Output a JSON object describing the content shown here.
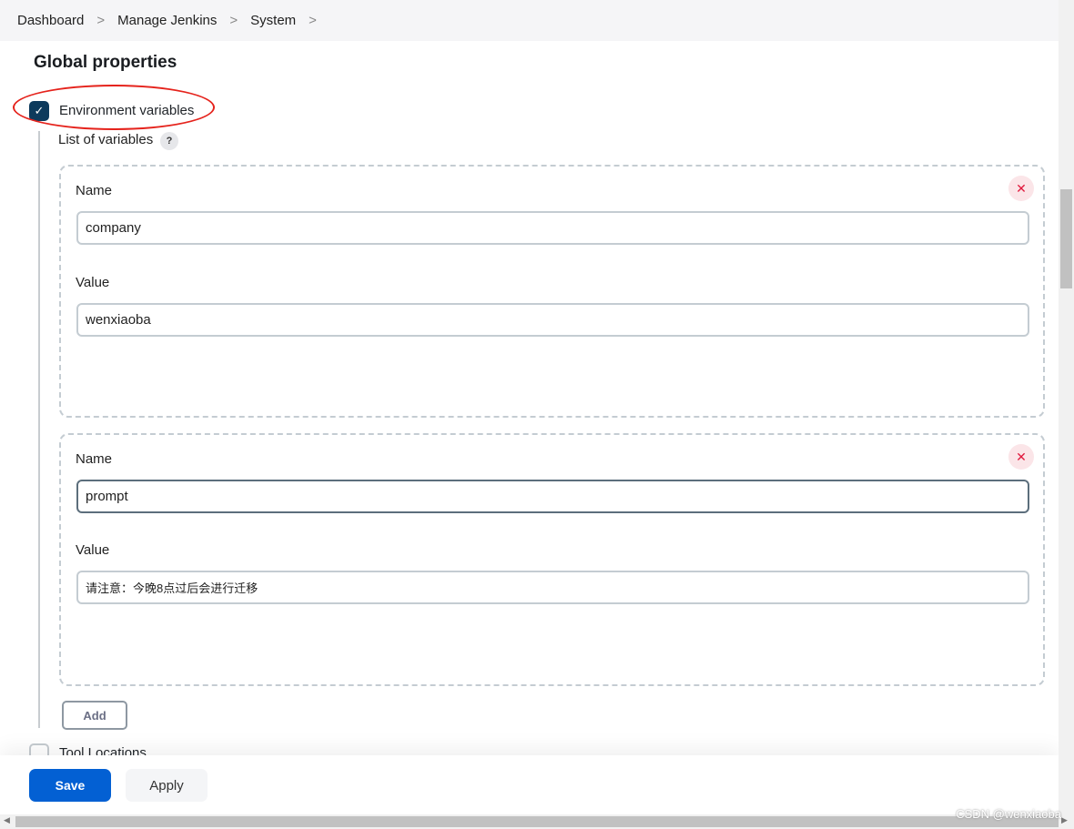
{
  "breadcrumb": [
    "Dashboard",
    "Manage Jenkins",
    "System"
  ],
  "section_title": "Global properties",
  "env_vars": {
    "label": "Environment variables",
    "checked": true,
    "list_label": "List of variables",
    "help": "?",
    "entries": [
      {
        "name_label": "Name",
        "name": "company",
        "value_label": "Value",
        "value": "wenxiaoba"
      },
      {
        "name_label": "Name",
        "name": "prompt",
        "value_label": "Value",
        "value": "请注意：今晚8点过后会进行迁移"
      }
    ],
    "add_label": "Add"
  },
  "tool_locations": {
    "label": "Tool Locations",
    "checked": false
  },
  "actions": {
    "save": "Save",
    "apply": "Apply"
  },
  "watermark": "CSDN @wenxiaoba",
  "colors": {
    "primary": "#0360d3",
    "checkbox": "#0d3a5c",
    "annotation": "#e5231c",
    "delete": "#e0193d"
  }
}
